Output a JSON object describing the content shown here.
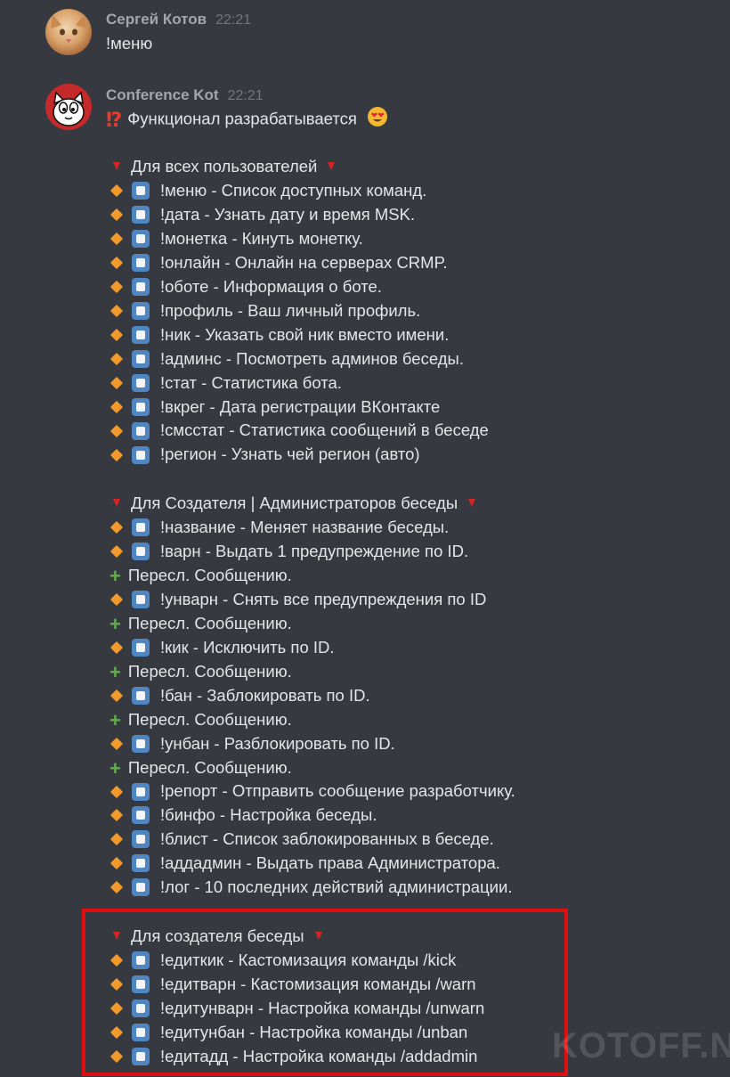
{
  "messages": [
    {
      "author": "Сергей Котов",
      "time": "22:21",
      "text": "!меню"
    },
    {
      "author": "Conference Kot",
      "time": "22:21",
      "intro": "Функционал разрабатывается",
      "sections": [
        {
          "title": "Для всех пользователей",
          "lines": [
            {
              "kind": "cmd",
              "text": "!меню - Список доступных команд."
            },
            {
              "kind": "cmd",
              "text": "!дата - Узнать дату и время MSK."
            },
            {
              "kind": "cmd",
              "text": "!монетка - Кинуть монетку."
            },
            {
              "kind": "cmd",
              "text": "!онлайн - Онлайн на серверах CRMP."
            },
            {
              "kind": "cmd",
              "text": "!оботе - Информация о боте."
            },
            {
              "kind": "cmd",
              "text": "!профиль - Ваш личный профиль."
            },
            {
              "kind": "cmd",
              "text": "!ник - Указать свой ник вместо имени."
            },
            {
              "kind": "cmd",
              "text": "!админс - Посмотреть админов беседы."
            },
            {
              "kind": "cmd",
              "text": "!стат - Статистика бота."
            },
            {
              "kind": "cmd",
              "text": "!вкрег - Дата регистрации ВКонтакте"
            },
            {
              "kind": "cmd",
              "text": "!смсстат - Статистика сообщений в беседе"
            },
            {
              "kind": "cmd",
              "text": "!регион - Узнать чей регион (авто)"
            }
          ]
        },
        {
          "title": "Для Создателя | Администраторов беседы",
          "lines": [
            {
              "kind": "cmd",
              "text": "!название - Меняет название беседы."
            },
            {
              "kind": "cmd",
              "text": "!варн - Выдать 1 предупреждение по ID."
            },
            {
              "kind": "note",
              "text": "Пересл. Сообщению."
            },
            {
              "kind": "cmd",
              "text": "!унварн - Снять все предупреждения по ID"
            },
            {
              "kind": "note",
              "text": "Пересл. Сообщению."
            },
            {
              "kind": "cmd",
              "text": "!кик - Исключить по ID."
            },
            {
              "kind": "note",
              "text": "Пересл. Сообщению."
            },
            {
              "kind": "cmd",
              "text": "!бан - Заблокировать по ID."
            },
            {
              "kind": "note",
              "text": "Пересл. Сообщению."
            },
            {
              "kind": "cmd",
              "text": "!унбан - Разблокировать по ID."
            },
            {
              "kind": "note",
              "text": "Пересл. Сообщению."
            },
            {
              "kind": "cmd",
              "text": "!репорт - Отправить сообщение разработчику."
            },
            {
              "kind": "cmd",
              "text": "!бинфо - Настройка беседы."
            },
            {
              "kind": "cmd",
              "text": "!блист - Список заблокированных в беседе."
            },
            {
              "kind": "cmd",
              "text": "!аддадмин - Выдать права Администратора."
            },
            {
              "kind": "cmd",
              "text": "!лог - 10 последних действий администрации."
            }
          ]
        },
        {
          "title": "Для создателя беседы",
          "lines": [
            {
              "kind": "cmd",
              "text": "!едиткик - Кастомизация команды /kick"
            },
            {
              "kind": "cmd",
              "text": "!едитварн - Кастомизация команды /warn"
            },
            {
              "kind": "cmd",
              "text": "!едитунварн - Настройка команды /unwarn"
            },
            {
              "kind": "cmd",
              "text": "!едитунбан - Настройка команды /unban"
            },
            {
              "kind": "cmd",
              "text": "!едитадд - Настройка команды /addadmin"
            }
          ]
        }
      ]
    }
  ],
  "watermark": "KOTOFF.NET",
  "colors": {
    "background": "#36393f",
    "highlight_box": "#e01010",
    "diamond": "#f19a2b",
    "plus": "#5fb04b"
  }
}
